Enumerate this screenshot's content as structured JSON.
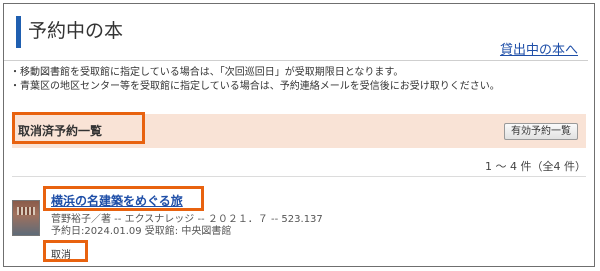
{
  "header": {
    "title": "予約中の本",
    "borrowed_link": "貸出中の本へ"
  },
  "notes": [
    "・移動図書館を受取館に指定している場合は、「次回巡回日」が受取期限日となります。",
    "・青葉区の地区センター等を受取館に指定している場合は、予約連絡メールを受信後にお受け取りください。"
  ],
  "section": {
    "title": "取消済予約一覧",
    "active_button": "有効予約一覧"
  },
  "result_count": "1 〜 4 件（全4 件）",
  "items": [
    {
      "title": "横浜の名建築をめぐる旅",
      "author_line": "菅野裕子／著 -- エクスナレッジ -- ２０２１．７ -- 523.137",
      "reserve_line": "予約日:2024.01.09 受取館: 中央図書館",
      "status": "取消"
    }
  ],
  "colors": {
    "accent_blue": "#1f5fb0",
    "link_blue": "#1f4fa8",
    "section_bg": "#f9e3d6",
    "highlight_orange": "#e8620f"
  }
}
